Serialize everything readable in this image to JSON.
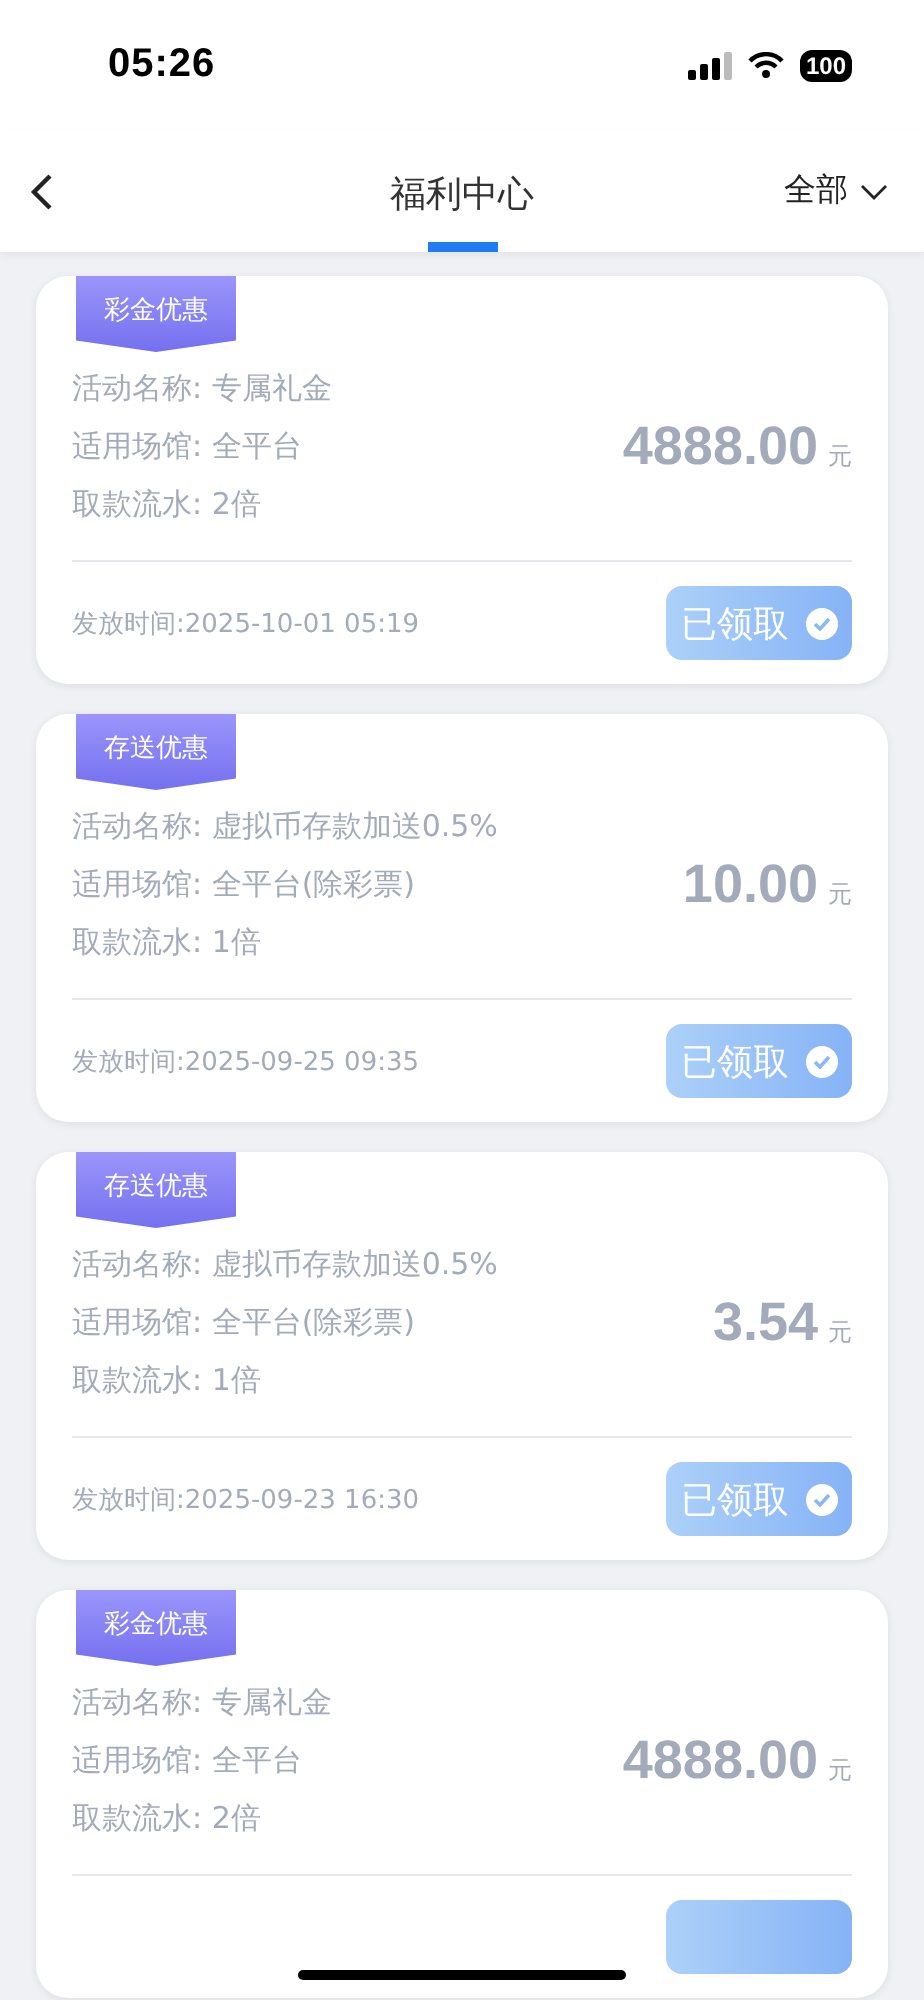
{
  "status_bar": {
    "time": "05:26",
    "battery": "100"
  },
  "header": {
    "title": "福利中心",
    "filter": "全部"
  },
  "cards": [
    {
      "tag": "彩金优惠",
      "lines": [
        "活动名称: 专属礼金",
        "适用场馆: 全平台",
        "取款流水: 2倍"
      ],
      "amount": "4888.00",
      "unit": "元",
      "time": "发放时间:2025-10-01 05:19",
      "button": {
        "label": "已领取",
        "claimed": true
      }
    },
    {
      "tag": "存送优惠",
      "lines": [
        "活动名称: 虚拟币存款加送0.5%",
        "适用场馆: 全平台(除彩票)",
        "取款流水: 1倍"
      ],
      "amount": "10.00",
      "unit": "元",
      "time": "发放时间:2025-09-25 09:35",
      "button": {
        "label": "已领取",
        "claimed": true
      }
    },
    {
      "tag": "存送优惠",
      "lines": [
        "活动名称: 虚拟币存款加送0.5%",
        "适用场馆: 全平台(除彩票)",
        "取款流水: 1倍"
      ],
      "amount": "3.54",
      "unit": "元",
      "time": "发放时间:2025-09-23 16:30",
      "button": {
        "label": "已领取",
        "claimed": true
      }
    },
    {
      "tag": "彩金优惠",
      "lines": [
        "活动名称: 专属礼金",
        "适用场馆: 全平台",
        "取款流水: 2倍"
      ],
      "amount": "4888.00",
      "unit": "元",
      "button": {
        "claimed": true
      }
    }
  ]
}
